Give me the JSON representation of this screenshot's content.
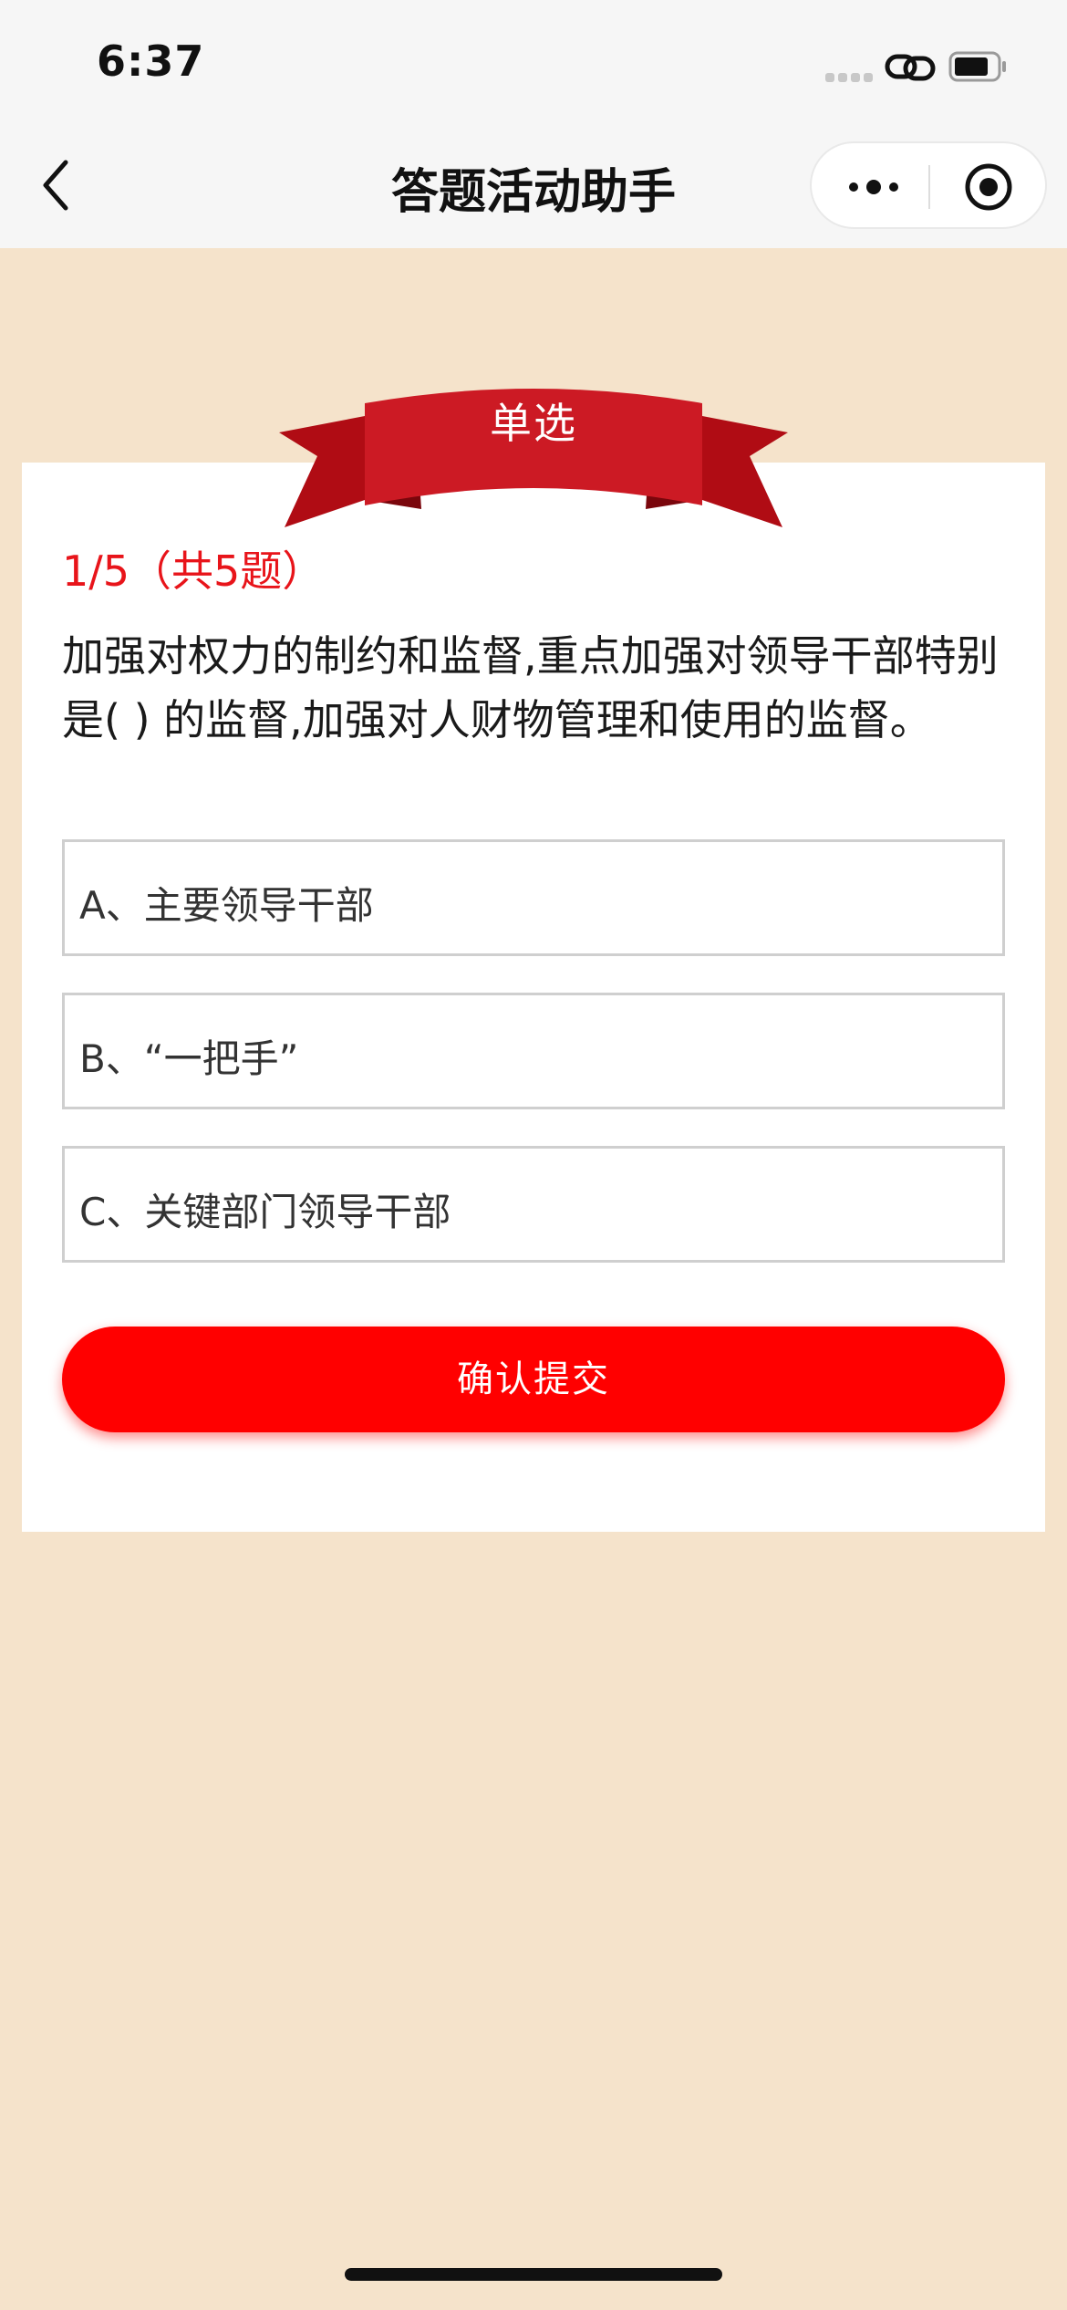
{
  "status_bar": {
    "time": "6:37"
  },
  "nav": {
    "title": "答题活动助手"
  },
  "quiz": {
    "type_label": "单选",
    "progress": "1/5（共5题）",
    "question": "加强对权力的制约和监督,重点加强对领导干部特别是( ) 的监督,加强对人财物管理和使用的监督。",
    "options": [
      {
        "label": "A、主要领导干部"
      },
      {
        "label": "B、“一把手”"
      },
      {
        "label": "C、关键部门领导干部"
      }
    ],
    "submit_label": "确认提交"
  },
  "colors": {
    "background": "#f5e3cb",
    "accent_red": "#ff0000",
    "ribbon_red": "#cc1a24",
    "progress_red": "#e8141a"
  },
  "icons": [
    "back-icon",
    "more-icon",
    "target-icon",
    "link-icon",
    "battery-icon",
    "signal-icon"
  ]
}
